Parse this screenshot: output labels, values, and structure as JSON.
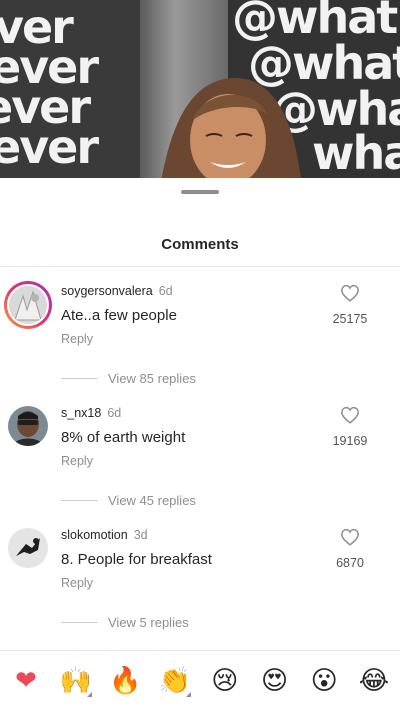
{
  "video": {
    "wall_left_lines": [
      "ver",
      "ever",
      "ever",
      "ever"
    ],
    "wall_right_lines": [
      "@what",
      "@what",
      "@what",
      "wha"
    ]
  },
  "sheet": {
    "title": "Comments"
  },
  "comments": [
    {
      "username": "soygersonvalera",
      "age": "6d",
      "text": "Ate..a few people",
      "reply_label": "Reply",
      "likes": "25175",
      "view_replies": "View 85 replies"
    },
    {
      "username": "s_nx18",
      "age": "6d",
      "text": "8% of earth weight",
      "reply_label": "Reply",
      "likes": "19169",
      "view_replies": "View 45 replies"
    },
    {
      "username": "slokomotion",
      "age": "3d",
      "text": "8. People for breakfast",
      "reply_label": "Reply",
      "likes": "6870",
      "view_replies": "View 5 replies"
    }
  ],
  "emoji_bar": [
    "❤",
    "🙌",
    "🔥",
    "👏",
    "😢",
    "😍",
    "😮",
    "😂"
  ],
  "colors": {
    "heart": "#ed4956",
    "secondary_text": "#8e8e8e"
  }
}
